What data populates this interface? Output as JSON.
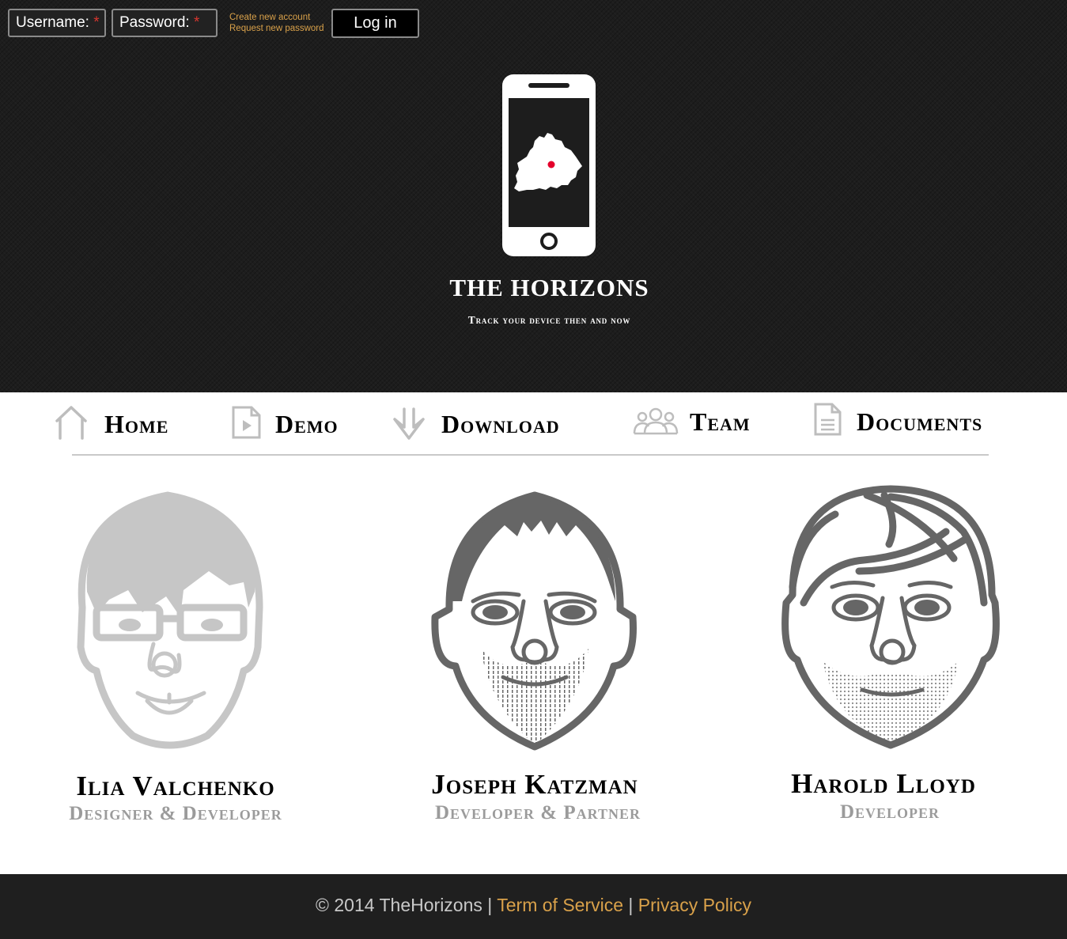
{
  "login": {
    "username_label": "Username:",
    "password_label": "Password:",
    "required_mark": "*",
    "create_account": "Create new account",
    "request_password": "Request new password",
    "login_button": "Log in"
  },
  "brand": {
    "title": "THE HORIZONS",
    "tagline": "Track your device then and now",
    "logo_icon": "phone-map-icon",
    "accent_color": "#d9a14a",
    "marker_color": "#e4002b"
  },
  "nav": {
    "items": [
      {
        "label": "Home",
        "icon": "home-icon"
      },
      {
        "label": "Demo",
        "icon": "play-document-icon"
      },
      {
        "label": "Download",
        "icon": "download-arrow-icon"
      },
      {
        "label": "Team",
        "icon": "team-icon"
      },
      {
        "label": "Documents",
        "icon": "document-icon"
      }
    ]
  },
  "team": {
    "members": [
      {
        "name": "Ilia Valchenko",
        "role": "Designer & Developer"
      },
      {
        "name": "Joseph Katzman",
        "role": "Developer & Partner"
      },
      {
        "name": "Harold Lloyd",
        "role": "Developer"
      }
    ]
  },
  "footer": {
    "copyright": "© 2014 TheHorizons",
    "separator": "|",
    "terms": "Term of Service",
    "privacy": "Privacy Policy"
  }
}
